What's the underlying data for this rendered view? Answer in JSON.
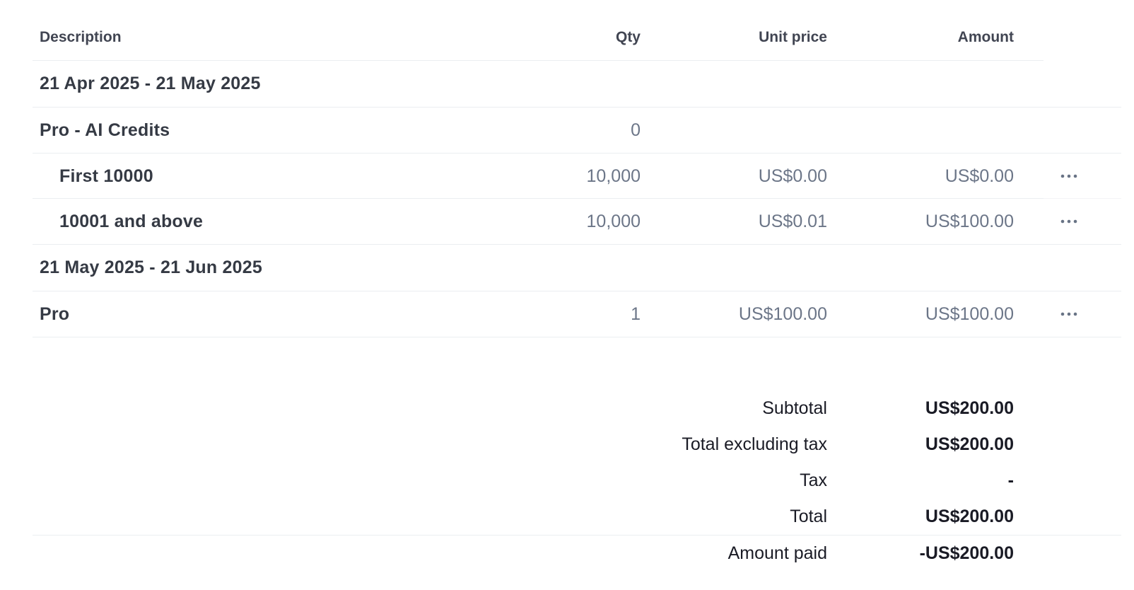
{
  "table": {
    "headers": {
      "description": "Description",
      "qty": "Qty",
      "unit_price": "Unit price",
      "amount": "Amount"
    },
    "periods": [
      {
        "label": "21 Apr 2025 - 21 May 2025",
        "items": [
          {
            "description": "Pro - AI Credits",
            "qty": "0",
            "unit_price": "",
            "amount": "",
            "indent": false,
            "has_menu": false
          },
          {
            "description": "First 10000",
            "qty": "10,000",
            "unit_price": "US$0.00",
            "amount": "US$0.00",
            "indent": true,
            "has_menu": true
          },
          {
            "description": "10001 and above",
            "qty": "10,000",
            "unit_price": "US$0.01",
            "amount": "US$100.00",
            "indent": true,
            "has_menu": true
          }
        ]
      },
      {
        "label": "21 May 2025 - 21 Jun 2025",
        "items": [
          {
            "description": "Pro",
            "qty": "1",
            "unit_price": "US$100.00",
            "amount": "US$100.00",
            "indent": false,
            "has_menu": true
          }
        ]
      }
    ]
  },
  "summary": {
    "subtotal_label": "Subtotal",
    "subtotal_value": "US$200.00",
    "total_excl_tax_label": "Total excluding tax",
    "total_excl_tax_value": "US$200.00",
    "tax_label": "Tax",
    "tax_value": "-",
    "total_label": "Total",
    "total_value": "US$200.00",
    "amount_paid_label": "Amount paid",
    "amount_paid_value": "-US$200.00"
  },
  "icons": {
    "row_menu": "more-horizontal-icon"
  },
  "colors": {
    "text_primary": "#353a44",
    "text_secondary": "#6c7688",
    "divider": "#ebeef1"
  }
}
